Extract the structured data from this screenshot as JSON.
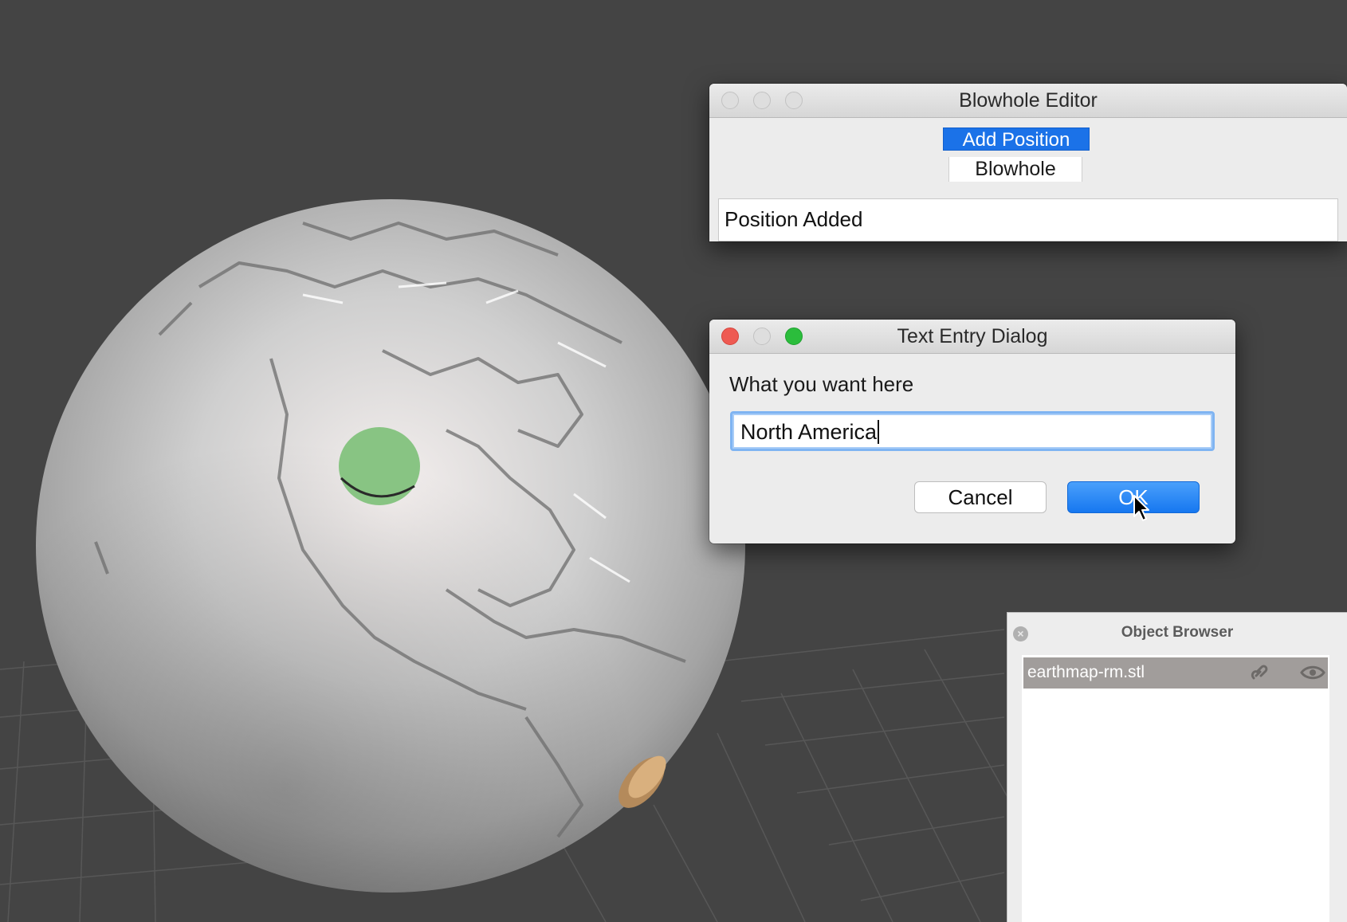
{
  "blowhole_editor": {
    "title": "Blowhole Editor",
    "add_position_label": "Add Position",
    "selector_value": "Blowhole",
    "status_text": "Position Added"
  },
  "text_entry_dialog": {
    "title": "Text Entry Dialog",
    "prompt": "What you want here",
    "input_value": "North America",
    "cancel_label": "Cancel",
    "ok_label": "OK"
  },
  "object_browser": {
    "title": "Object Browser",
    "items": [
      {
        "label": "earthmap-rm.stl"
      }
    ]
  },
  "colors": {
    "accent_blue": "#1b72e8",
    "marker_green": "#88c483",
    "close_red": "#ee5a52",
    "zoom_green": "#2bbd3c",
    "viewport_bg": "#444444"
  },
  "icons": [
    "link-icon",
    "eye-icon",
    "close-icon",
    "pointer-cursor-icon"
  ]
}
